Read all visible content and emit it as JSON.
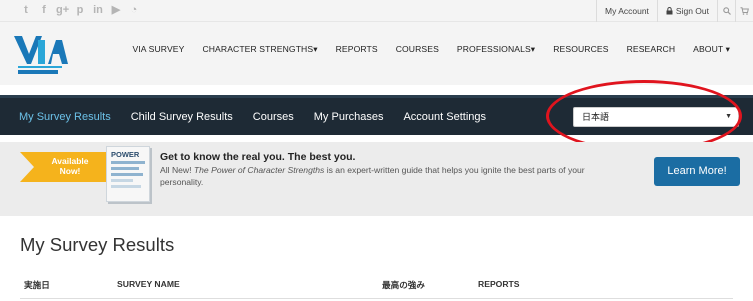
{
  "topbar": {
    "social_icons": [
      "twitter-icon",
      "facebook-icon",
      "google-plus-icon",
      "pinterest-icon",
      "linkedin-icon",
      "youtube-icon",
      "rss-icon"
    ],
    "my_account": "My Account",
    "sign_out": "Sign Out"
  },
  "header": {
    "nav": [
      "VIA SURVEY",
      "CHARACTER STRENGTHS▾",
      "REPORTS",
      "COURSES",
      "PROFESSIONALS▾",
      "RESOURCES",
      "RESEARCH",
      "ABOUT ▾"
    ]
  },
  "subnav": {
    "items": [
      "My Survey Results",
      "Child Survey Results",
      "Courses",
      "My Purchases",
      "Account Settings"
    ],
    "active_index": 0,
    "language_selected": "日本語"
  },
  "promo": {
    "ribbon": "Available Now!",
    "heading": "Get to know the real you. The best you.",
    "body_prefix": "All New! ",
    "body_title": "The Power of Character Strengths",
    "body_suffix": " is an expert-written guide that helps you ignite the best parts of your personality.",
    "button": "Learn More!"
  },
  "main": {
    "title": "My Survey Results",
    "columns": [
      "実施日",
      "SURVEY NAME",
      "最高の強み",
      "REPORTS"
    ]
  },
  "colors": {
    "dark_bar": "#1e2a35",
    "active_link": "#6cc1e8",
    "ribbon": "#f5b31c",
    "button": "#1b6da3",
    "highlight_ring": "#e0141e"
  }
}
